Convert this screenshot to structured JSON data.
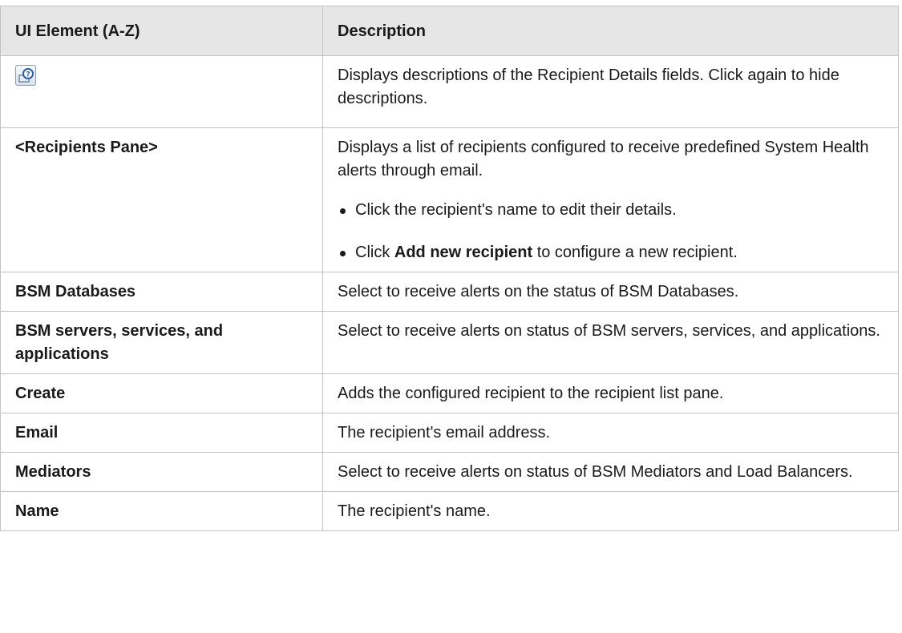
{
  "table": {
    "headers": [
      "UI Element (A-Z)",
      "Description"
    ],
    "rows": [
      {
        "element": "",
        "icon": "help-descriptions-icon",
        "description": "Displays descriptions of the Recipient Details fields. Click again to hide descriptions."
      },
      {
        "element": "<Recipients Pane>",
        "description": "Displays a list of recipients configured to receive predefined System Health alerts through email.",
        "bullets": [
          {
            "text": "Click the recipient's name to edit their details."
          },
          {
            "prefix": "Click ",
            "bold": "Add new recipient",
            "suffix": " to configure a new recipient."
          }
        ]
      },
      {
        "element": "BSM Databases",
        "description": "Select to receive alerts on the status of BSM Databases."
      },
      {
        "element": "BSM servers, services, and applications",
        "description": "Select to receive alerts on status of BSM servers, services, and applications."
      },
      {
        "element": "Create",
        "description": "Adds the configured recipient to the recipient list pane."
      },
      {
        "element": "Email",
        "description": "The recipient's email address."
      },
      {
        "element": "Mediators",
        "description": "Select to receive alerts on status of BSM Mediators and Load Balancers."
      },
      {
        "element": "Name",
        "description": "The recipient's name."
      }
    ]
  }
}
